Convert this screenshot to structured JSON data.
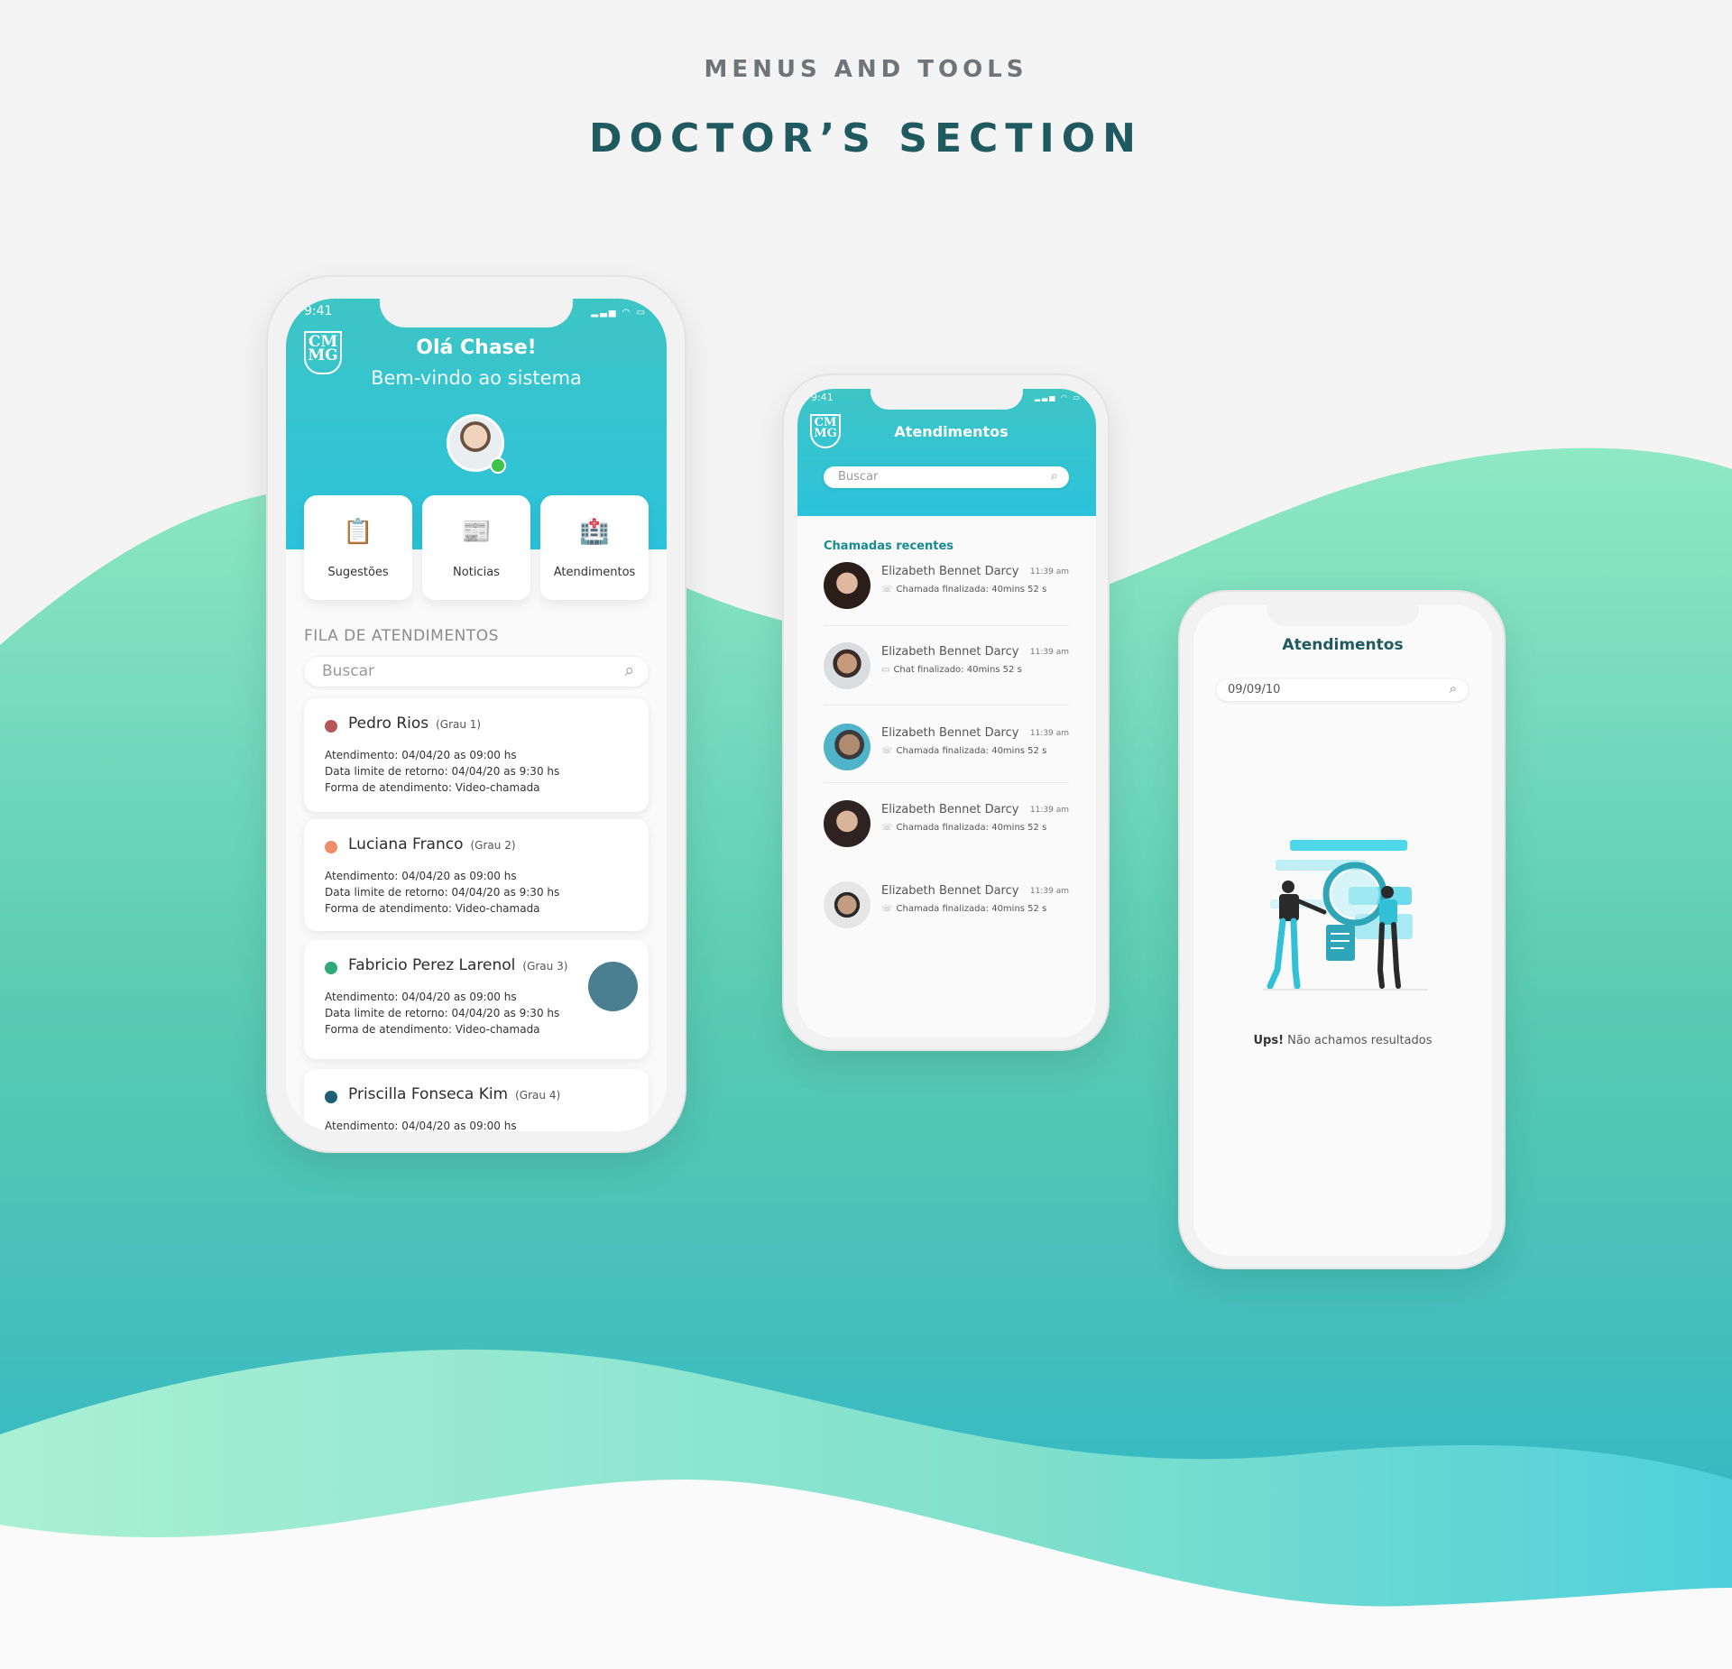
{
  "page": {
    "label": "MENUS AND TOOLS",
    "title": "DOCTOR’S SECTION"
  },
  "colors": {
    "accent": "#2bc3dc",
    "teal": "#3ec5c5",
    "title": "#1f5a60",
    "wave_light": "#8fe8c4",
    "wave_dark": "#35b8c4"
  },
  "phone1": {
    "status_time": "9:41",
    "greeting": "Olá Chase!",
    "welcome": "Bem-vindo ao sistema",
    "tiles": [
      {
        "label": "Sugestões",
        "icon": "clipboard-icon"
      },
      {
        "label": "Noticias",
        "icon": "newspaper-icon"
      },
      {
        "label": "Atendimentos",
        "icon": "hospital-icon"
      }
    ],
    "queue_title": "FILA DE ATENDIMENTOS",
    "search_placeholder": "Buscar",
    "queue": [
      {
        "name": "Pedro Rios",
        "grade": "(Grau 1)",
        "color": "#b5575a",
        "line1": "Atendimento: 04/04/20 as 09:00 hs",
        "line2": "Data limite de retorno: 04/04/20 as 9:30 hs",
        "line3": "Forma de atendimento: Video-chamada"
      },
      {
        "name": "Luciana Franco",
        "grade": "(Grau 2)",
        "color": "#ef8c6c",
        "line1": "Atendimento: 04/04/20 as 09:00 hs",
        "line2": "Data limite de retorno: 04/04/20 as 9:30 hs",
        "line3": "Forma de atendimento: Video-chamada"
      },
      {
        "name": "Fabricio Perez Larenol",
        "grade": "(Grau 3)",
        "color": "#2fa977",
        "line1": "Atendimento: 04/04/20 as 09:00 hs",
        "line2": "Data limite de retorno: 04/04/20 as 9:30 hs",
        "line3": "Forma de atendimento: Video-chamada"
      },
      {
        "name": "Priscilla Fonseca Kim",
        "grade": "(Grau 4)",
        "color": "#1f5e76",
        "line1": "Atendimento: 04/04/20 as 09:00 hs"
      }
    ]
  },
  "phone2": {
    "status_time": "9:41",
    "title": "Atendimentos",
    "search_placeholder": "Buscar",
    "recent_title": "Chamadas recentes",
    "calls": [
      {
        "name": "Elizabeth Bennet Darcy",
        "time": "11:39 am",
        "icon": "phone-icon",
        "status": "Chamada finalizada: 40mins 52 s"
      },
      {
        "name": "Elizabeth Bennet Darcy",
        "time": "11:39 am",
        "icon": "chat-icon",
        "status": "Chat finalizado: 40mins 52 s"
      },
      {
        "name": "Elizabeth Bennet Darcy",
        "time": "11:39 am",
        "icon": "phone-icon",
        "status": "Chamada finalizada: 40mins 52 s"
      },
      {
        "name": "Elizabeth Bennet Darcy",
        "time": "11:39 am",
        "icon": "phone-icon",
        "status": "Chamada finalizada: 40mins 52 s"
      },
      {
        "name": "Elizabeth Bennet Darcy",
        "time": "11:39 am",
        "icon": "phone-icon",
        "status": "Chamada finalizada: 40mins 52 s"
      }
    ]
  },
  "phone3": {
    "title": "Atendimentos",
    "search_value": "09/09/10",
    "empty_bold": "Ups!",
    "empty_text": "Não achamos resultados"
  }
}
